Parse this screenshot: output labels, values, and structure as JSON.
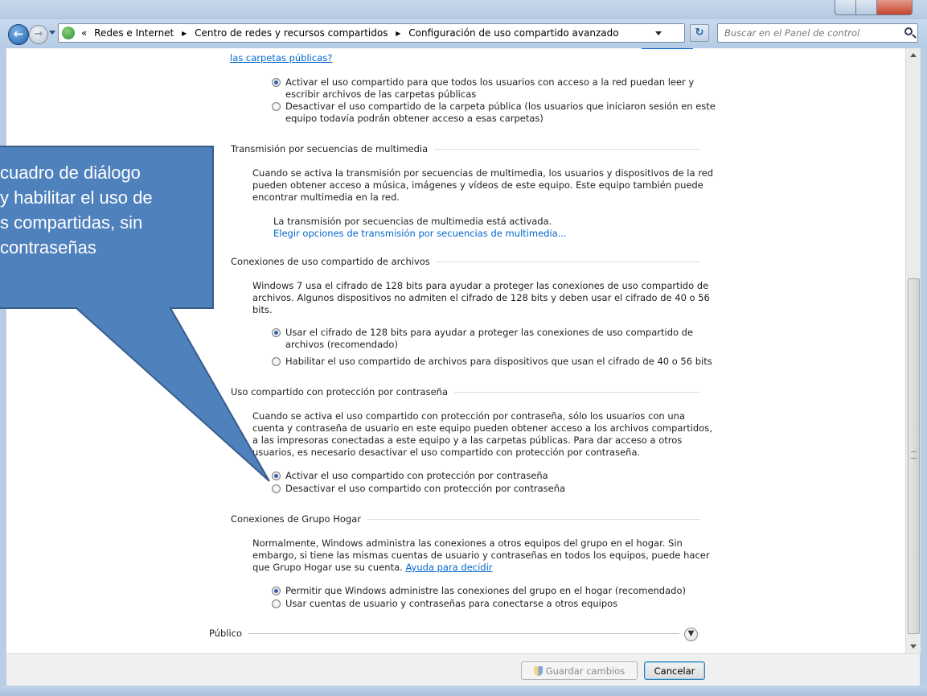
{
  "window": {
    "close_color": "#c8452e"
  },
  "address_bar": {
    "prefix": "«",
    "crumbs": [
      "Redes e Internet",
      "Centro de redes y recursos compartidos",
      "Configuración de uso compartido avanzado"
    ],
    "separator": "▶"
  },
  "search": {
    "placeholder": "Buscar en el Panel de control"
  },
  "public_folders": {
    "question_link": "las carpetas públicas?",
    "options": [
      {
        "line1": "Activar el uso compartido para que todos los usuarios con acceso a la red puedan leer y",
        "line2": "escribir archivos de las carpetas públicas",
        "selected": true
      },
      {
        "line1": "Desactivar el uso compartido de la carpeta pública (los usuarios que iniciaron sesión en este",
        "line2": "equipo todavía podrán obtener acceso a esas carpetas)",
        "selected": false
      }
    ]
  },
  "media_streaming": {
    "heading": "Transmisión por secuencias de multimedia",
    "desc": [
      "Cuando se activa la transmisión por secuencias de multimedia, los usuarios y dispositivos de la red",
      "pueden obtener acceso a música, imágenes y vídeos de este equipo. Este equipo también puede",
      "encontrar multimedia en la red."
    ],
    "status": "La transmisión por secuencias de multimedia está activada.",
    "link": "Elegir opciones de transmisión por secuencias de multimedia..."
  },
  "file_sharing": {
    "heading": "Conexiones de uso compartido de archivos",
    "desc": [
      "Windows 7 usa el cifrado de 128 bits para ayudar a proteger las conexiones de uso compartido de",
      "archivos. Algunos dispositivos no admiten el cifrado de 128 bits y deben usar el cifrado de 40 o 56",
      "bits."
    ],
    "options": [
      {
        "line1": "Usar el cifrado de 128 bits para ayudar a proteger las conexiones de uso compartido de",
        "line2": "archivos (recomendado)",
        "selected": true
      },
      {
        "line1": "Habilitar el uso compartido de archivos para dispositivos que usan el cifrado de 40 o 56 bits",
        "line2": "",
        "selected": false
      }
    ]
  },
  "password_sharing": {
    "heading": "Uso compartido con protección por contraseña",
    "desc": [
      "Cuando se activa el uso compartido con protección por contraseña, sólo los usuarios con una",
      "cuenta y contraseña de usuario en este equipo pueden obtener acceso a los archivos compartidos,",
      "a las impresoras conectadas a este equipo y a las carpetas públicas. Para dar acceso a otros",
      "usuarios, es necesario desactivar el uso compartido con protección por contraseña."
    ],
    "options": [
      {
        "label": "Activar el uso compartido con protección por contraseña",
        "selected": true
      },
      {
        "label": "Desactivar el uso compartido con protección por contraseña",
        "selected": false
      }
    ]
  },
  "homegroup": {
    "heading": "Conexiones de Grupo Hogar",
    "desc": [
      "Normalmente, Windows administra las conexiones a otros equipos del grupo en el hogar. Sin",
      "embargo, si tiene las mismas cuentas de usuario y contraseñas en todos los equipos, puede hacer",
      "que Grupo Hogar use su cuenta."
    ],
    "help_link": "Ayuda para decidir",
    "options": [
      {
        "label": "Permitir que Windows administre las conexiones del grupo en el hogar (recomendado)",
        "selected": true
      },
      {
        "label": "Usar cuentas de usuario y contraseñas para conectarse a otros equipos",
        "selected": false
      }
    ]
  },
  "public_profile": {
    "heading": "Público",
    "expand_icon": "chevron-down-icon"
  },
  "footer": {
    "save_label": "Guardar cambios",
    "cancel_label": "Cancelar"
  },
  "callout": {
    "fill": "#4f81bd",
    "stroke": "#385d8a",
    "lines": [
      "cuadro de diálogo",
      "y habilitar el uso de",
      "s compartidas, sin",
      "contraseñas"
    ]
  }
}
